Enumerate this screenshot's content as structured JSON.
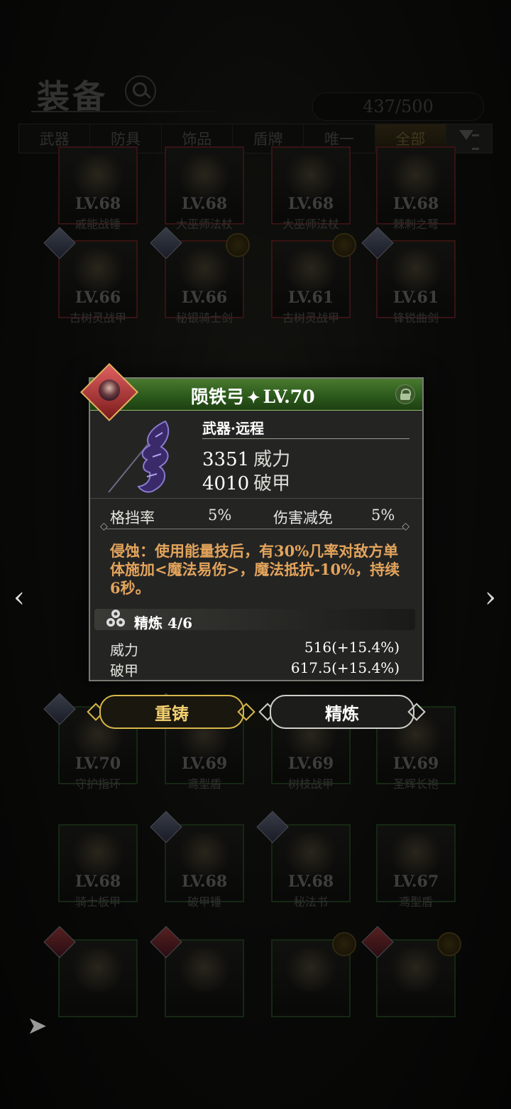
{
  "header": {
    "title": "装备",
    "capacity": "437/500"
  },
  "tabs": [
    "武器",
    "防具",
    "饰品",
    "盾牌",
    "唯一",
    "全部"
  ],
  "grid_items": [
    {
      "lv": "LV.68",
      "name": "戚能战锤"
    },
    {
      "lv": "LV.68",
      "name": "大巫师法杖"
    },
    {
      "lv": "LV.68",
      "name": "大巫师法杖"
    },
    {
      "lv": "LV.68",
      "name": "棘刺之弩"
    },
    {
      "lv": "LV.66",
      "name": "古树灵战甲"
    },
    {
      "lv": "LV.66",
      "name": "秘银骑士剑"
    },
    {
      "lv": "LV.61",
      "name": "古树灵战甲"
    },
    {
      "lv": "LV.61",
      "name": "锋锐曲剑"
    },
    {
      "lv": "LV.70",
      "name": "守护指环"
    },
    {
      "lv": "LV.69",
      "name": "鸢型盾"
    },
    {
      "lv": "LV.69",
      "name": "树枝战甲"
    },
    {
      "lv": "LV.69",
      "name": "圣辉长袍"
    },
    {
      "lv": "LV.68",
      "name": "骑士板甲"
    },
    {
      "lv": "LV.68",
      "name": "破甲锤"
    },
    {
      "lv": "LV.68",
      "name": "秘法书"
    },
    {
      "lv": "LV.67",
      "name": "鸢型盾"
    },
    {
      "lv": "",
      "name": ""
    },
    {
      "lv": "",
      "name": ""
    },
    {
      "lv": "",
      "name": ""
    },
    {
      "lv": "",
      "name": ""
    }
  ],
  "popup": {
    "name": "陨铁弓",
    "star": "✦",
    "level": "LV.70",
    "type": "武器·远程",
    "stat1_value": "3351",
    "stat1_label": "威力",
    "stat2_value": "4010",
    "stat2_label": "破甲",
    "sub1_label": "格挡率",
    "sub1_value": "5%",
    "sub2_label": "伤害减免",
    "sub2_value": "5%",
    "effect": "侵蚀：使用能量技后，有30%几率对敌方单体施加<魔法易伤>，魔法抵抗-10%，持续6秒。",
    "refine_label": "精炼 4/6",
    "refine_rows": [
      {
        "name": "威力",
        "value": "516(+15.4%)"
      },
      {
        "name": "破甲",
        "value": "617.5(+15.4%)"
      }
    ]
  },
  "buttons": {
    "reforge": "重铸",
    "refine": "精炼"
  },
  "colors": {
    "header_green": "#2c5a1c",
    "effect_orange": "#e3a45c",
    "reforge_gold": "#d8b64a"
  }
}
